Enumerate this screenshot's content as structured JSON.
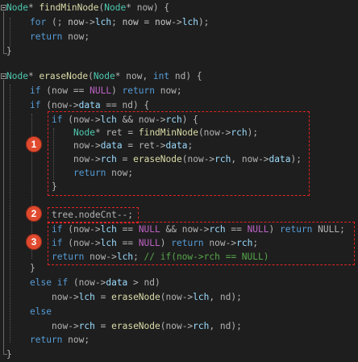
{
  "code": {
    "lines": [
      [
        [
          "Node",
          "t-type"
        ],
        [
          "* ",
          "t-op"
        ],
        [
          "findMinNode",
          "t-fn"
        ],
        [
          "(",
          "t-op"
        ],
        [
          "Node",
          "t-type"
        ],
        [
          "* now) {",
          "t-op"
        ]
      ],
      [
        [
          "for",
          "t-kw"
        ],
        [
          " (; ",
          "t-op"
        ],
        [
          "now",
          "t-id2"
        ],
        [
          "->",
          "t-op"
        ],
        [
          "lch",
          "t-id"
        ],
        [
          "; ",
          "t-op"
        ],
        [
          "now",
          "t-id2"
        ],
        [
          " = ",
          "t-op"
        ],
        [
          "now",
          "t-id2"
        ],
        [
          "->",
          "t-op"
        ],
        [
          "lch",
          "t-id"
        ],
        [
          ");",
          "t-op"
        ]
      ],
      [
        [
          "return",
          "t-kw"
        ],
        [
          " now;",
          "t-op"
        ]
      ],
      [
        [
          "}",
          "t-op"
        ]
      ],
      [
        [
          "",
          "t-op"
        ]
      ],
      [
        [
          "Node",
          "t-type"
        ],
        [
          "* ",
          "t-op"
        ],
        [
          "eraseNode",
          "t-fn"
        ],
        [
          "(",
          "t-op"
        ],
        [
          "Node",
          "t-type"
        ],
        [
          "* now, ",
          "t-op"
        ],
        [
          "int",
          "t-kw"
        ],
        [
          " nd) {",
          "t-op"
        ]
      ],
      [
        [
          "if",
          "t-kw"
        ],
        [
          " (now == ",
          "t-op"
        ],
        [
          "NULL",
          "t-mac"
        ],
        [
          ") ",
          "t-op"
        ],
        [
          "return",
          "t-kw"
        ],
        [
          " now;",
          "t-op"
        ]
      ],
      [
        [
          "if",
          "t-kw"
        ],
        [
          " (now->",
          "t-op"
        ],
        [
          "data",
          "t-id"
        ],
        [
          " == nd) {",
          "t-op"
        ]
      ],
      [
        [
          "if",
          "t-kw"
        ],
        [
          " (now->",
          "t-op"
        ],
        [
          "lch",
          "t-id"
        ],
        [
          " && now->",
          "t-op"
        ],
        [
          "rch",
          "t-id"
        ],
        [
          ") {",
          "t-op"
        ]
      ],
      [
        [
          "Node",
          "t-type"
        ],
        [
          "* ret = ",
          "t-op"
        ],
        [
          "findMinNode",
          "t-fn"
        ],
        [
          "(now->",
          "t-op"
        ],
        [
          "rch",
          "t-id"
        ],
        [
          ");",
          "t-op"
        ]
      ],
      [
        [
          "now->",
          "t-op"
        ],
        [
          "data",
          "t-id"
        ],
        [
          " = ret->",
          "t-op"
        ],
        [
          "data",
          "t-id"
        ],
        [
          ";",
          "t-op"
        ]
      ],
      [
        [
          "now->",
          "t-op"
        ],
        [
          "rch",
          "t-id"
        ],
        [
          " = ",
          "t-op"
        ],
        [
          "eraseNode",
          "t-fn"
        ],
        [
          "(now->",
          "t-op"
        ],
        [
          "rch",
          "t-id"
        ],
        [
          ", now->",
          "t-op"
        ],
        [
          "data",
          "t-id"
        ],
        [
          ");",
          "t-op"
        ]
      ],
      [
        [
          "return",
          "t-kw"
        ],
        [
          " now;",
          "t-op"
        ]
      ],
      [
        [
          "}",
          "t-op"
        ]
      ],
      [
        [
          "",
          "t-op"
        ]
      ],
      [
        [
          "tree.nodeCnt--;",
          "t-op"
        ]
      ],
      [
        [
          "if",
          "t-kw"
        ],
        [
          " (now->",
          "t-op"
        ],
        [
          "lch",
          "t-id"
        ],
        [
          " == ",
          "t-op"
        ],
        [
          "NULL",
          "t-mac"
        ],
        [
          " && now->",
          "t-op"
        ],
        [
          "rch",
          "t-id"
        ],
        [
          " == ",
          "t-op"
        ],
        [
          "NULL",
          "t-mac"
        ],
        [
          ") ",
          "t-op"
        ],
        [
          "return",
          "t-kw"
        ],
        [
          " NULL;",
          "t-op"
        ]
      ],
      [
        [
          "if",
          "t-kw"
        ],
        [
          " (now->",
          "t-op"
        ],
        [
          "lch",
          "t-id"
        ],
        [
          " == ",
          "t-op"
        ],
        [
          "NULL",
          "t-mac"
        ],
        [
          ") ",
          "t-op"
        ],
        [
          "return",
          "t-kw"
        ],
        [
          " now->",
          "t-op"
        ],
        [
          "rch",
          "t-id"
        ],
        [
          ";",
          "t-op"
        ]
      ],
      [
        [
          "return",
          "t-kw"
        ],
        [
          " now->",
          "t-op"
        ],
        [
          "lch",
          "t-id"
        ],
        [
          "; ",
          "t-op"
        ],
        [
          "// if(now->rch == NULL)",
          "t-cm"
        ]
      ],
      [
        [
          "}",
          "t-op"
        ]
      ],
      [
        [
          "else",
          "t-kw"
        ],
        [
          " ",
          "t-op"
        ],
        [
          "if",
          "t-kw"
        ],
        [
          " (now->",
          "t-op"
        ],
        [
          "data",
          "t-id"
        ],
        [
          " > nd)",
          "t-op"
        ]
      ],
      [
        [
          "now->",
          "t-op"
        ],
        [
          "lch",
          "t-id"
        ],
        [
          " = ",
          "t-op"
        ],
        [
          "eraseNode",
          "t-fn"
        ],
        [
          "(now->",
          "t-op"
        ],
        [
          "lch",
          "t-id"
        ],
        [
          ", nd);",
          "t-op"
        ]
      ],
      [
        [
          "else",
          "t-kw"
        ]
      ],
      [
        [
          "now->",
          "t-op"
        ],
        [
          "rch",
          "t-id"
        ],
        [
          " = ",
          "t-op"
        ],
        [
          "eraseNode",
          "t-fn"
        ],
        [
          "(now->",
          "t-op"
        ],
        [
          "rch",
          "t-id"
        ],
        [
          ", nd);",
          "t-op"
        ]
      ],
      [
        [
          "return",
          "t-kw"
        ],
        [
          " now;",
          "t-op"
        ]
      ],
      [
        [
          "}",
          "t-op"
        ]
      ]
    ]
  },
  "badges": [
    "1",
    "2",
    "3"
  ]
}
